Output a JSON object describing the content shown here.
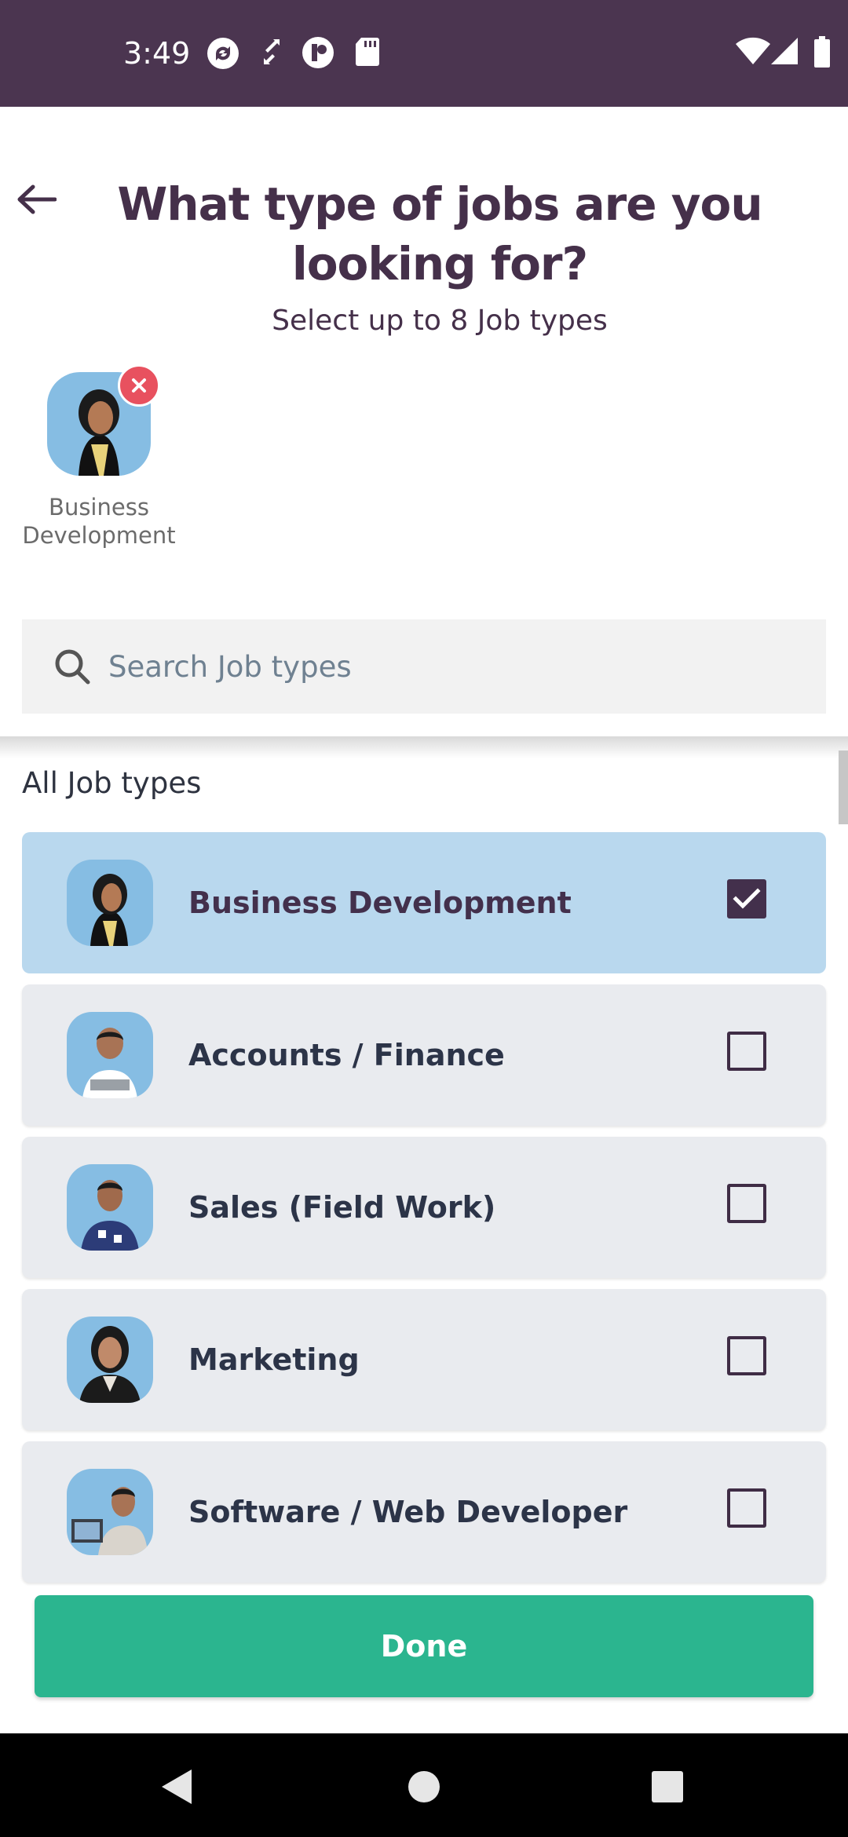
{
  "status_bar": {
    "time": "3:49",
    "left_icons": [
      "sync-icon",
      "arrows-icon",
      "app-badge-icon",
      "sd-card-icon"
    ],
    "right_icons": [
      "wifi-icon",
      "signal-icon",
      "battery-icon"
    ]
  },
  "header": {
    "title_line1": "What type of jobs are you",
    "title_line2": "looking for?",
    "subtitle": "Select up to 8 Job types"
  },
  "selected_chips": [
    {
      "label_line1": "Business",
      "label_line2": "Development"
    }
  ],
  "search": {
    "placeholder": "Search Job types",
    "value": ""
  },
  "list": {
    "section_title": "All Job types",
    "items": [
      {
        "label": "Business Development",
        "checked": true
      },
      {
        "label": "Accounts / Finance",
        "checked": false
      },
      {
        "label": "Sales (Field Work)",
        "checked": false
      },
      {
        "label": "Marketing",
        "checked": false
      },
      {
        "label": "Software / Web Developer",
        "checked": false
      }
    ]
  },
  "done_button": {
    "label": "Done"
  },
  "colors": {
    "status_bar": "#4b3550",
    "title": "#45304a",
    "selected_row": "#b9d8ee",
    "row": "#e9ebef",
    "done": "#2bb58f",
    "remove": "#e8515f"
  }
}
